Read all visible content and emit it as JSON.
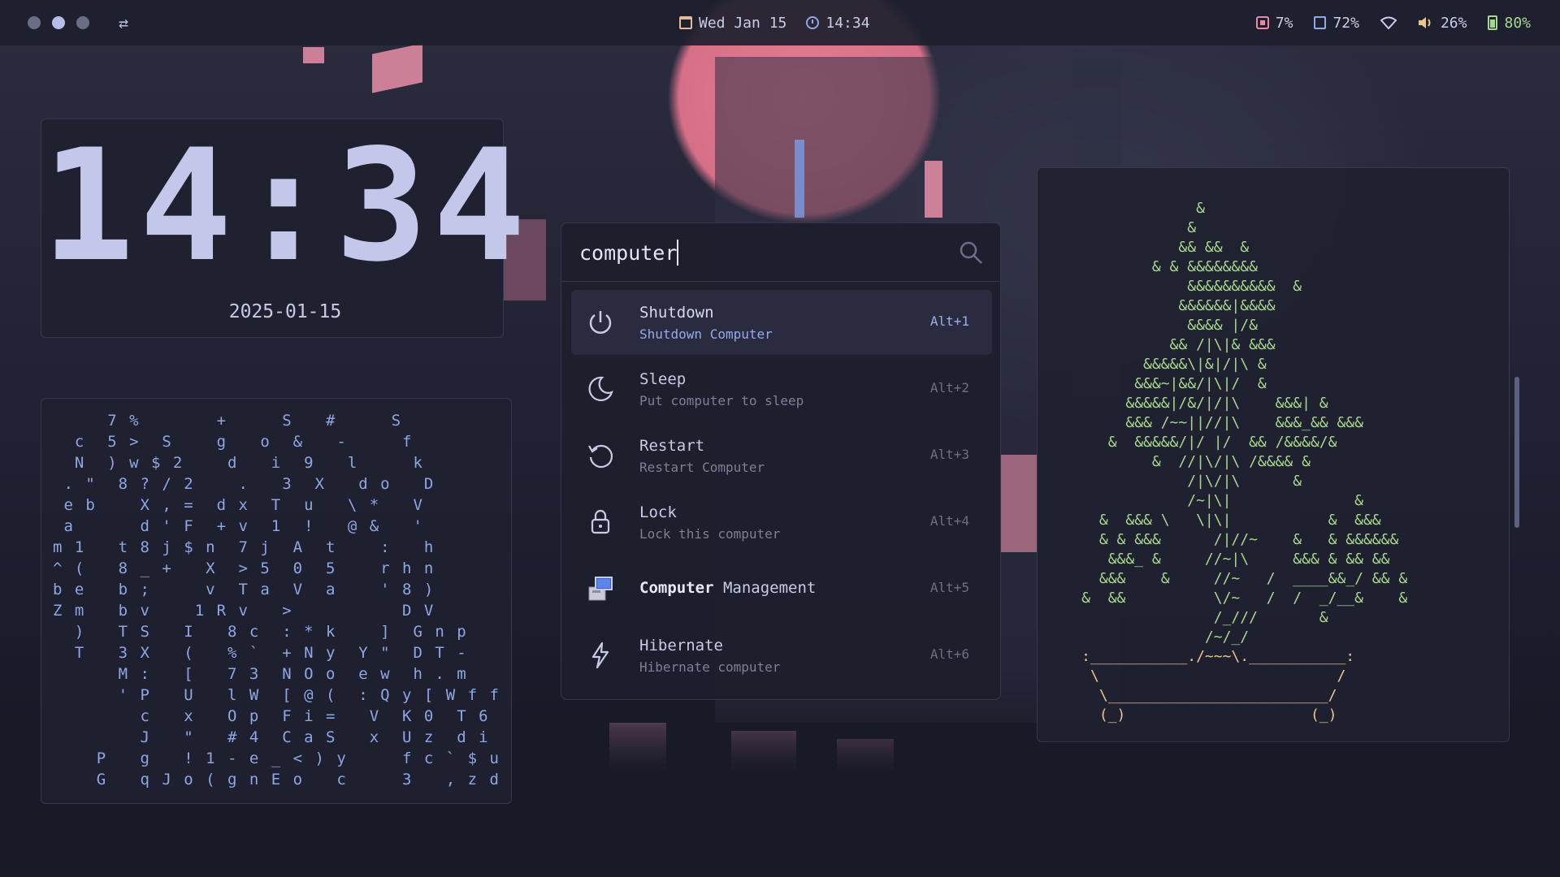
{
  "topbar": {
    "workspaces": [
      "1",
      "2",
      "3"
    ],
    "active_workspace": 2,
    "swap_icon": "⇄",
    "date": "Wed Jan 15",
    "time": "14:34",
    "cpu": "7%",
    "disk": "72%",
    "volume": "26%",
    "battery": "80%"
  },
  "clock_widget": {
    "time": "14:34",
    "date": "2025-01-15"
  },
  "matrix": {
    "lines": [
      "     7 %       +     S   #     S",
      "  c  5 >  S    g   o  &   -     f",
      "  N  ) w $ 2    d   i  9   l     k",
      " . \"  8 ? / 2    .   3  X   d o   D",
      " e b    X , =  d x  T  u   \\ *   V",
      " a      d ' F  + v  1  !   @ &   '",
      "m 1   t 8 j $ n  7 j  A  t    :   h",
      "^ (   8 _ +   X  > 5  0  5    r h n",
      "b e   b ;     v  T a  V  a    ' 8 )",
      "Z m   b v    1 R v   >          D V",
      "  )   T S   I   8 c  : * k    ]  G n p",
      "  T   3 X   (   % `  + N y  Y \"  D T -",
      "      M :   [   7 3  N O o  e w  h . m",
      "      ' P   U   l W  [ @ (  : Q y [ W f f",
      "        c   x   O p  F i =   V  K 0  T 6",
      "        J   \"   # 4  C a S   x  U z  d i",
      "    P   g   ! 1 - e _ < ) y     f c ` $ u",
      "    G   q J o ( g n E o   c     3   , z d"
    ]
  },
  "launcher": {
    "query": "computer",
    "search_icon": "search-icon",
    "results": [
      {
        "title": "Shutdown",
        "subtitle": "Shutdown Computer",
        "shortcut": "Alt+1",
        "icon": "power-icon",
        "selected": true
      },
      {
        "title": "Sleep",
        "subtitle": "Put computer to sleep",
        "shortcut": "Alt+2",
        "icon": "moon-icon"
      },
      {
        "title": "Restart",
        "subtitle": "Restart Computer",
        "shortcut": "Alt+3",
        "icon": "restart-icon"
      },
      {
        "title": "Lock",
        "subtitle": "Lock this computer",
        "shortcut": "Alt+4",
        "icon": "lock-icon"
      },
      {
        "title_highlight": "Computer",
        "title_rest": " Management",
        "shortcut": "Alt+5",
        "icon": "computer-management-icon"
      },
      {
        "title": "Hibernate",
        "subtitle": "Hibernate computer",
        "shortcut": "Alt+6",
        "icon": "bolt-icon"
      }
    ]
  },
  "ascii_tree": {
    "lines": [
      "                  &",
      "                 &",
      "                && &&  &",
      "             & & &&&&&&&&",
      "                 &&&&&&&&&&  &",
      "                &&&&&&|&&&&",
      "                 &&&& |/&",
      "               && /|\\|& &&&",
      "            &&&&&\\|&|/|\\ &",
      "           &&&~|&&/|\\|/  &",
      "          &&&&&|/&/|/|\\    &&&| &",
      "          &&& /~~||//|\\    &&&_&& &&&",
      "        &  &&&&&/|/ |/  && /&&&&/&",
      "             &  //|\\/|\\ /&&&& &",
      "                 /|\\/|\\      &",
      "                 /~|\\|              &",
      "       &  &&& \\   \\|\\|           &  &&&",
      "       & & &&&      /|//~    &   & &&&&&&",
      "        &&&_ &     //~|\\     &&& & && &&",
      "       &&&    &     //~   /  ____&&_/ && &",
      "     &  &&          \\/~   /  /  _/__&    &",
      "                    /_///       &",
      "                   /~/_/"
    ],
    "base_lines": [
      "     :___________./~~~\\.___________:",
      "      \\                           /",
      "       \\_________________________/",
      "       (_)                     (_)"
    ]
  },
  "colors": {
    "accent_blue": "#8fa8ea",
    "accent_pink": "#ea8aa2",
    "accent_green": "#a7d88e",
    "accent_yellow": "#e8c88a",
    "panel_bg": "#202130"
  }
}
